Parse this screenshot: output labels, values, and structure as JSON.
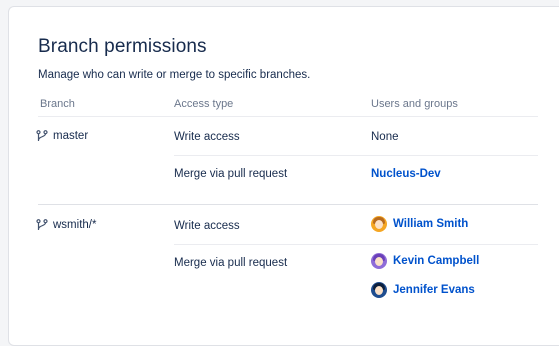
{
  "header": {
    "title": "Branch permissions",
    "subtitle": "Manage who can write or merge to specific branches."
  },
  "table": {
    "columns": [
      "Branch",
      "Access type",
      "Users and groups"
    ],
    "rows": [
      {
        "branch": "master",
        "permissions": [
          {
            "access": "Write access",
            "users": [
              {
                "name": "None",
                "type": "text"
              }
            ]
          },
          {
            "access": "Merge via pull request",
            "users": [
              {
                "name": "Nucleus-Dev",
                "type": "group"
              }
            ]
          }
        ]
      },
      {
        "branch": "wsmith/*",
        "permissions": [
          {
            "access": "Write access",
            "users": [
              {
                "name": "William Smith",
                "type": "user",
                "avatar_color": "#f5a623"
              }
            ]
          },
          {
            "access": "Merge via pull request",
            "users": [
              {
                "name": "Kevin Campbell",
                "type": "user",
                "avatar_color": "#8e6cd8"
              },
              {
                "name": "Jennifer Evans",
                "type": "user",
                "avatar_color": "#1f4d8f"
              }
            ]
          }
        ]
      }
    ]
  },
  "icons": {
    "branch": "branch-icon"
  },
  "colors": {
    "link": "#0052cc",
    "text": "#172b4d",
    "header_text": "#6b778c"
  }
}
